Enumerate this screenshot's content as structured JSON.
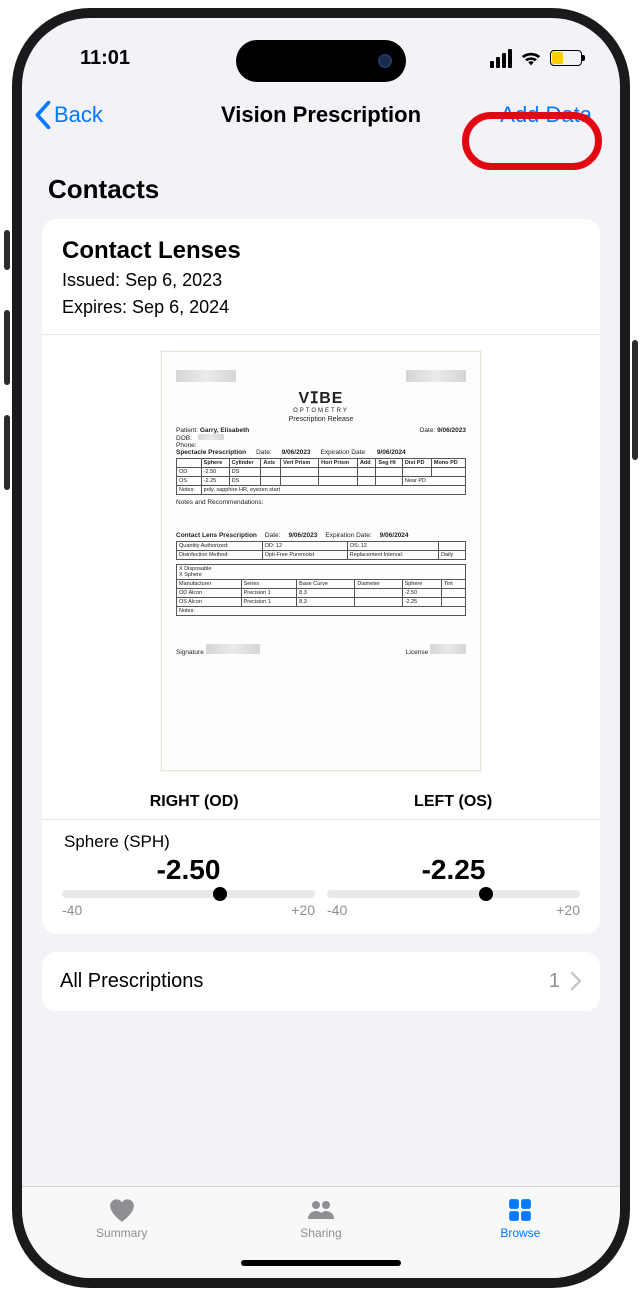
{
  "status": {
    "time": "11:01"
  },
  "nav": {
    "back": "Back",
    "title": "Vision Prescription",
    "add": "Add Data"
  },
  "section": {
    "title": "Contacts"
  },
  "card": {
    "title": "Contact Lenses",
    "issued_label": "Issued:",
    "issued_value": "Sep 6, 2023",
    "expires_label": "Expires:",
    "expires_value": "Sep 6, 2024"
  },
  "doc": {
    "brand": "VⵊBE",
    "brand_sub": "OPTOMETRY",
    "release": "Prescription Release",
    "patient_label": "Patient:",
    "patient_name": "Garry, Elisabeth",
    "dob_label": "DOB:",
    "phone_label": "Phone:",
    "date_label": "Date:",
    "date_value": "9/06/2023",
    "spectacle_header": "Spectacle Prescription",
    "spec_date_label": "Date:",
    "spec_date": "9/06/2023",
    "spec_exp_label": "Expiration Date:",
    "spec_exp": "9/06/2024",
    "od": "OD",
    "os": "OS",
    "od_sphere": "-2.50",
    "os_sphere": "-2.25",
    "cyl": "DS",
    "notes": "poly, sapphire HR, eyezen start",
    "notes_header": "Notes and Recommendations:",
    "cl_header": "Contact Lens Prescription",
    "cl_date": "9/06/2023",
    "cl_exp": "9/06/2024",
    "qty_label": "Quantity Authorized:",
    "qty_od": "OD: 12",
    "qty_os": "OS: 12",
    "method_label": "Disinfection Method:",
    "method": "Opti-Free Puremoist",
    "repl_label": "Replacement Interval:",
    "repl": "Daily",
    "xdisp": "X Disposable",
    "xsph": "X Sphere",
    "manuf": "Manufacturer",
    "series": "Series",
    "precision": "Precision 1",
    "alcon": "Alcon",
    "bc_label": "Base Curve",
    "bc": "8.3",
    "dia_label": "Diameter",
    "sph_label": "Sphere",
    "tint_label": "Tint",
    "od_cl": "-2.50",
    "os_cl": "-2.25",
    "cl_notes": "Notes:",
    "sig": "Signature",
    "lic": "License"
  },
  "rx": {
    "right_heading": "RIGHT (OD)",
    "left_heading": "LEFT (OS)",
    "sphere_label": "Sphere (SPH)",
    "right_value": "-2.50",
    "left_value": "-2.25",
    "min": "-40",
    "max": "+20",
    "right_percent": 62.5,
    "left_percent": 63.0
  },
  "all": {
    "label": "All Prescriptions",
    "count": "1"
  },
  "tabs": {
    "summary": "Summary",
    "sharing": "Sharing",
    "browse": "Browse"
  }
}
